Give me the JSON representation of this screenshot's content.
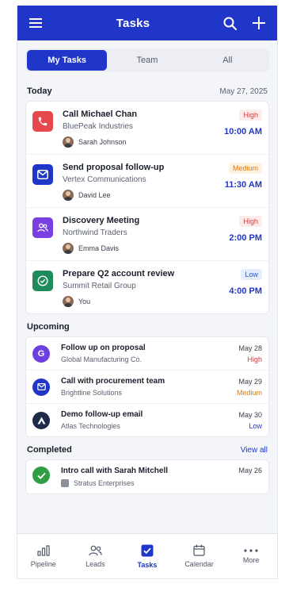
{
  "header": {
    "title": "Tasks",
    "menu_icon": "hamburger-icon",
    "search_icon": "search-icon",
    "add_icon": "plus-icon"
  },
  "segments": [
    {
      "label": "My Tasks",
      "active": true
    },
    {
      "label": "Team",
      "active": false
    },
    {
      "label": "All",
      "active": false
    }
  ],
  "today": {
    "label": "Today",
    "date": "May 27, 2025",
    "tasks": [
      {
        "title": "Call Michael Chan",
        "company": "BluePeak Industries",
        "owner": "Sarah Johnson",
        "priority": "High",
        "time": "10:00 AM",
        "icon": "phone-icon",
        "color": "#e5484d"
      },
      {
        "title": "Send proposal follow-up",
        "company": "Vertex Communications",
        "owner": "David Lee",
        "priority": "Medium",
        "time": "11:30 AM",
        "icon": "mail-icon",
        "color": "#1f36c9"
      },
      {
        "title": "Discovery Meeting",
        "company": "Northwind Traders",
        "owner": "Emma Davis",
        "priority": "High",
        "time": "2:00 PM",
        "icon": "people-icon",
        "color": "#7a3fe0"
      },
      {
        "title": "Prepare Q2 account review",
        "company": "Summit Retail Group",
        "owner": "You",
        "priority": "Low",
        "time": "4:00 PM",
        "icon": "check-circle-icon",
        "color": "#1f8a5a"
      }
    ]
  },
  "upcoming": {
    "label": "Upcoming",
    "items": [
      {
        "title": "Follow up on proposal",
        "company": "Global Manufacturing Co.",
        "date": "May 28",
        "priority": "High",
        "avatar_letter": "G",
        "color": "#6d3fe0"
      },
      {
        "title": "Call with procurement team",
        "company": "Brightline Solutions",
        "date": "May 29",
        "priority": "Medium",
        "avatar_letter": "",
        "icon": "mail-icon",
        "color": "#1f36c9"
      },
      {
        "title": "Demo follow-up email",
        "company": "Atlas Technologies",
        "date": "May 30",
        "priority": "Low",
        "avatar_letter": "",
        "icon": "atlas-logo-icon",
        "color": "#1e2a4a"
      }
    ]
  },
  "completed": {
    "label": "Completed",
    "view_all": "View all",
    "items": [
      {
        "title": "Intro call with Sarah Mitchell",
        "company": "Stratus Enterprises",
        "date": "May 26"
      }
    ]
  },
  "tabbar": [
    {
      "label": "Pipeline",
      "icon": "bar-chart-icon",
      "active": false
    },
    {
      "label": "Leads",
      "icon": "people-icon",
      "active": false
    },
    {
      "label": "Tasks",
      "icon": "checkbox-icon",
      "active": true
    },
    {
      "label": "Calendar",
      "icon": "calendar-icon",
      "active": false
    },
    {
      "label": "More",
      "icon": "more-dots-icon",
      "active": false
    }
  ]
}
